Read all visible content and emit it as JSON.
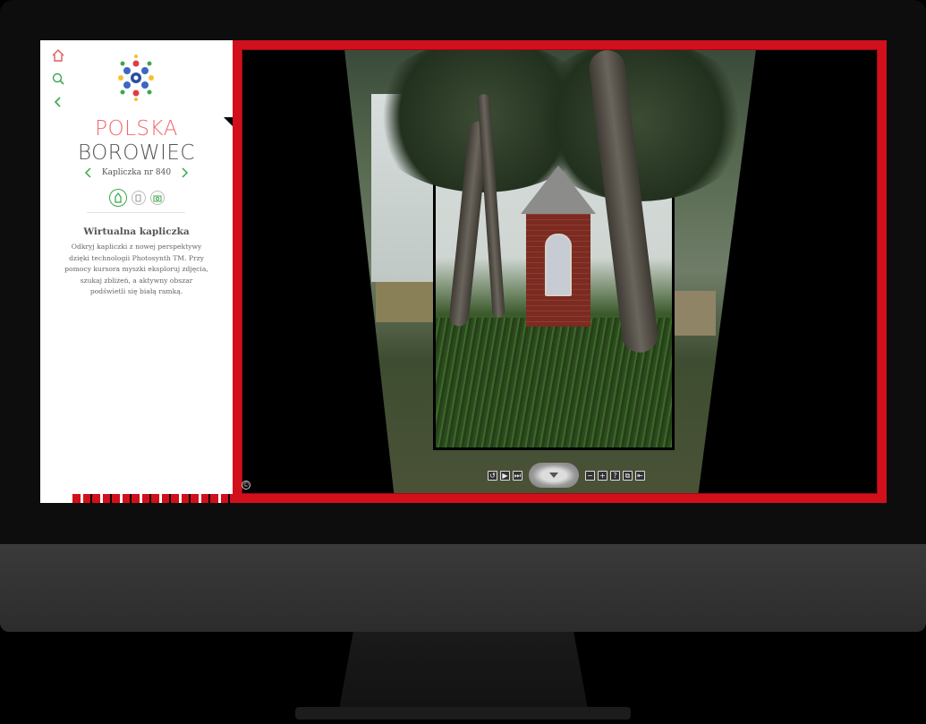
{
  "sidebar": {
    "title_line1": "POLSKA",
    "title_line2": "BOROWIEC",
    "nav_label": "Kapliczka nr 840",
    "section_title": "Wirtualna kapliczka",
    "section_text": "Odkryj kapliczki z nowej perspektywy dzięki technologii Photosynth TM. Przy pomocy kursora myszki eksploruj zdjęcia, szukaj zbliżeń, a aktywny obszar podświetli się białą ramką.",
    "icons": [
      "home-icon",
      "search-icon",
      "back-icon"
    ],
    "tools": [
      "shrine-icon",
      "document-icon",
      "camera-icon"
    ]
  },
  "viewer": {
    "copyright_symbol": "©",
    "controls": [
      "rotate-icon",
      "play-icon",
      "next-icon",
      "zoom-out-icon",
      "zoom-in-icon",
      "help-icon",
      "overlay-icon",
      "exit-icon"
    ]
  },
  "colors": {
    "accent_red": "#d2101c",
    "title_pink": "#f0686d",
    "accent_green": "#3aa84a"
  }
}
